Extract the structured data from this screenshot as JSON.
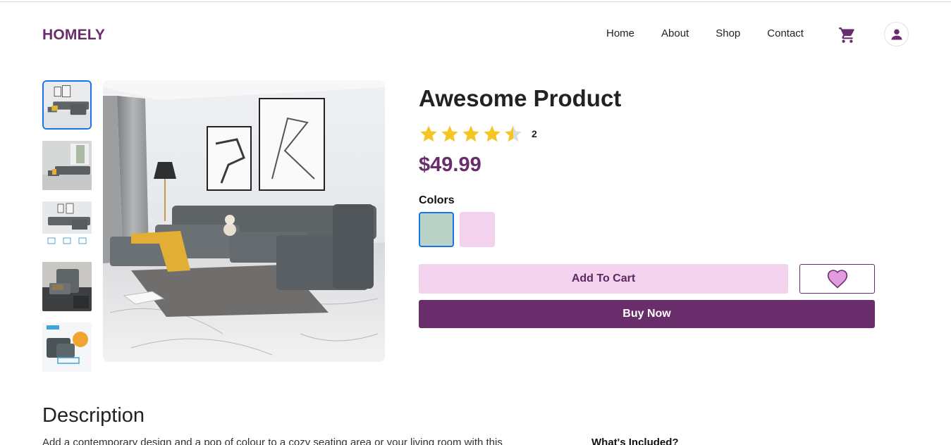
{
  "header": {
    "logo": "HOMELY",
    "nav": [
      "Home",
      "About",
      "Shop",
      "Contact"
    ]
  },
  "icons": {
    "cart": "cart-icon",
    "user": "user-icon",
    "wishlist": "heart-icon",
    "star": "star-icon"
  },
  "product": {
    "title": "Awesome Product",
    "rating": 4.5,
    "rating_max": 5,
    "rating_count": "2",
    "price": "$49.99",
    "colors_label": "Colors",
    "colors": [
      "#b9d3c8",
      "#f2d2ed"
    ],
    "selected_color_index": 0,
    "add_to_cart": "Add To Cart",
    "buy_now": "Buy Now"
  },
  "gallery": {
    "thumbnail_count": 5,
    "active_thumbnail": 0
  },
  "description": {
    "heading": "Description",
    "text": "Add a contemporary design and a pop of colour to a cozy seating area or your living room with this",
    "whats_included": "What's Included?"
  },
  "colors": {
    "brand": "#6a2d6c",
    "cart_button": "#f2d2ed",
    "buy_button": "#6a2d6c",
    "star": "#f3c623",
    "heart": "#e39be0",
    "focus": "#1a73e8"
  }
}
